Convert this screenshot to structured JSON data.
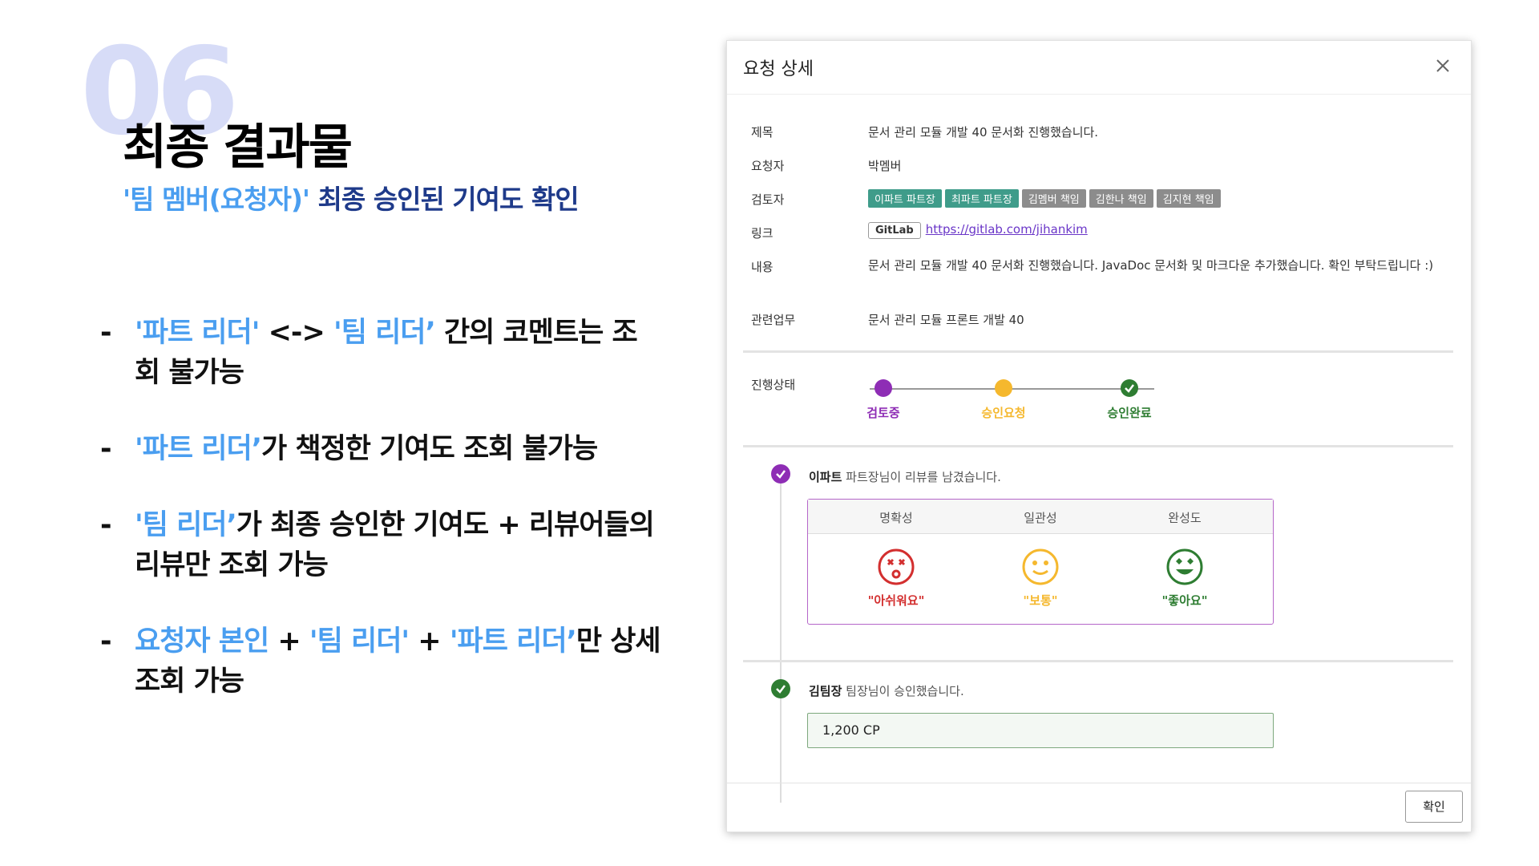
{
  "slide": {
    "number": "06",
    "title": "최종 결과물",
    "subtitle_hl": "'팀 멤버(요청자)'",
    "subtitle_rest": " 최종 승인된 기여도 확인",
    "bullets": [
      {
        "dash": "-",
        "p1_hl": "'파트 리더'",
        "p2": " <-> ",
        "p3_hl": "'팀 리더’",
        "p4": " 간의 코멘트는 조회 불가능"
      },
      {
        "dash": "-",
        "p1_hl": "'파트 리더’",
        "p2": "가 책정한 기여도 조회 불가능"
      },
      {
        "dash": "-",
        "p1_hl": "'팀 리더’",
        "p2": "가 최종 승인한 기여도 + 리뷰어들의 리뷰만 조회 가능"
      },
      {
        "dash": "-",
        "p1_hl": "요청자 본인",
        "p2": " + ",
        "p3_hl": "'팀 리더'",
        "p4": " + ",
        "p5_hl": "'파트 리더’",
        "p6": "만 상세 조회 가능"
      }
    ],
    "colors": {
      "highlight": "#4a9ef0",
      "subtitle": "#1e3a8a",
      "number": "#d7dcf7"
    }
  },
  "modal": {
    "title": "요청 상세",
    "close_icon": "close-icon",
    "fields": {
      "title_label": "제목",
      "title_value": "문서 관리 모듈 개발 40 문서화 진행했습니다.",
      "requester_label": "요청자",
      "requester_value": "박멤버",
      "reviewer_label": "검토자",
      "reviewers": [
        {
          "name": "이파트 파트장",
          "color": "teal"
        },
        {
          "name": "최파트 파트장",
          "color": "teal"
        },
        {
          "name": "김멤버 책임",
          "color": "grey"
        },
        {
          "name": "김한나 책임",
          "color": "grey"
        },
        {
          "name": "김지현 책임",
          "color": "grey"
        }
      ],
      "link_label": "링크",
      "link_badge": "GitLab",
      "link_url": "https://gitlab.com/jihankim",
      "content_label": "내용",
      "content_value": "문서 관리 모듈 개발 40 문서화 진행했습니다. JavaDoc 문서화 및 마크다운 추가했습니다. 확인 부탁드립니다 :)",
      "related_label": "관련업무",
      "related_value": "문서 관리 모듈 프론트 개발 40"
    },
    "progress": {
      "label": "진행상태",
      "steps": [
        {
          "label": "검토중",
          "color": "#8e2db5"
        },
        {
          "label": "승인요청",
          "color": "#f5b82e"
        },
        {
          "label": "승인완료",
          "color": "#2e7d32"
        }
      ]
    },
    "timeline": [
      {
        "name": "이파트",
        "text": " 파트장님이 리뷰를 남겼습니다."
      },
      {
        "name": "김팀장",
        "text": " 팀장님이 승인했습니다."
      }
    ],
    "review": {
      "headers": [
        "명확성",
        "일관성",
        "완성도"
      ],
      "ratings": [
        {
          "label": "\"아쉬워요\"",
          "color": "#d32f2f",
          "icon": "sad-face-icon"
        },
        {
          "label": "\"보통\"",
          "color": "#f5b82e",
          "icon": "neutral-face-icon"
        },
        {
          "label": "\"좋아요\"",
          "color": "#2e7d32",
          "icon": "happy-face-icon"
        }
      ]
    },
    "contribution": "1,200 CP",
    "ok_button": "확인"
  }
}
